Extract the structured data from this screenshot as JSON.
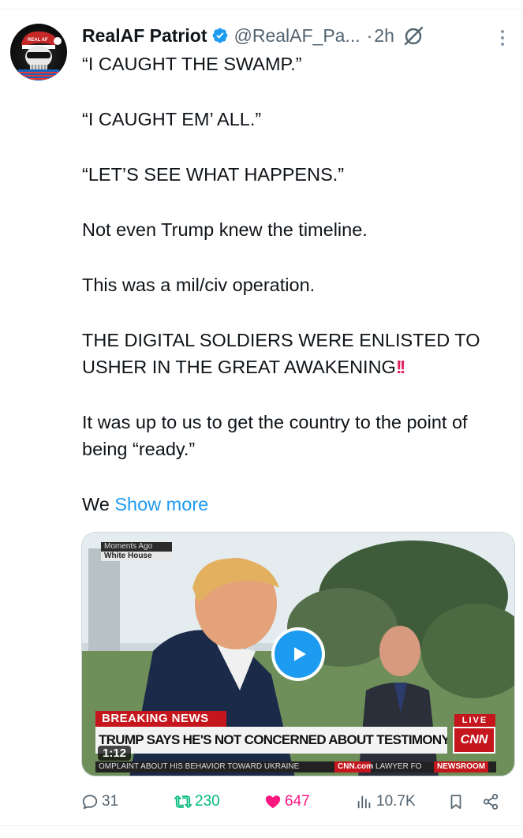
{
  "post": {
    "author": {
      "display_name": "RealAF Patriot",
      "handle": "@RealAF_Pa...",
      "verified_icon": "verified-badge-icon",
      "avatar_label": "REAL AF"
    },
    "dot": "·",
    "time": "2h",
    "text": {
      "p1": "“I CAUGHT THE SWAMP.”",
      "p2": "“I CAUGHT EM’ ALL.”",
      "p3": "“LET’S SEE WHAT HAPPENS.”",
      "p4": "Not even Trump knew the timeline.",
      "p5": "This was a mil/civ operation.",
      "p6": "THE DIGITAL SOLDIERS WERE ENLISTED TO USHER IN THE GREAT AWAKENING",
      "p6_emoji": "!!",
      "p7": "It was up to us to get the country to the point of being “ready.”",
      "p8": "We",
      "show_more": "Show more"
    },
    "media": {
      "moments": "Moments Ago",
      "location": "White House",
      "breaking": "BREAKING NEWS",
      "headline": "TRUMP SAYS HE'S NOT CONCERNED ABOUT TESTIMONY SO FAR",
      "live": "LIVE",
      "network": "CNN",
      "ticker_1": "OMPLAINT ABOUT HIS BEHAVIOR TOWARD UKRAINE",
      "ticker_2": "CNN.com",
      "ticker_3": "LAWYER FO",
      "ticker_4": "NEWSROOM",
      "duration": "1:12"
    },
    "actions": {
      "replies": "31",
      "reposts": "230",
      "likes": "647",
      "views": "10.7K"
    }
  },
  "colors": {
    "accent": "#1d9bf0",
    "like": "#f91880",
    "repost": "#00ba7c",
    "text_secondary": "#536471"
  }
}
